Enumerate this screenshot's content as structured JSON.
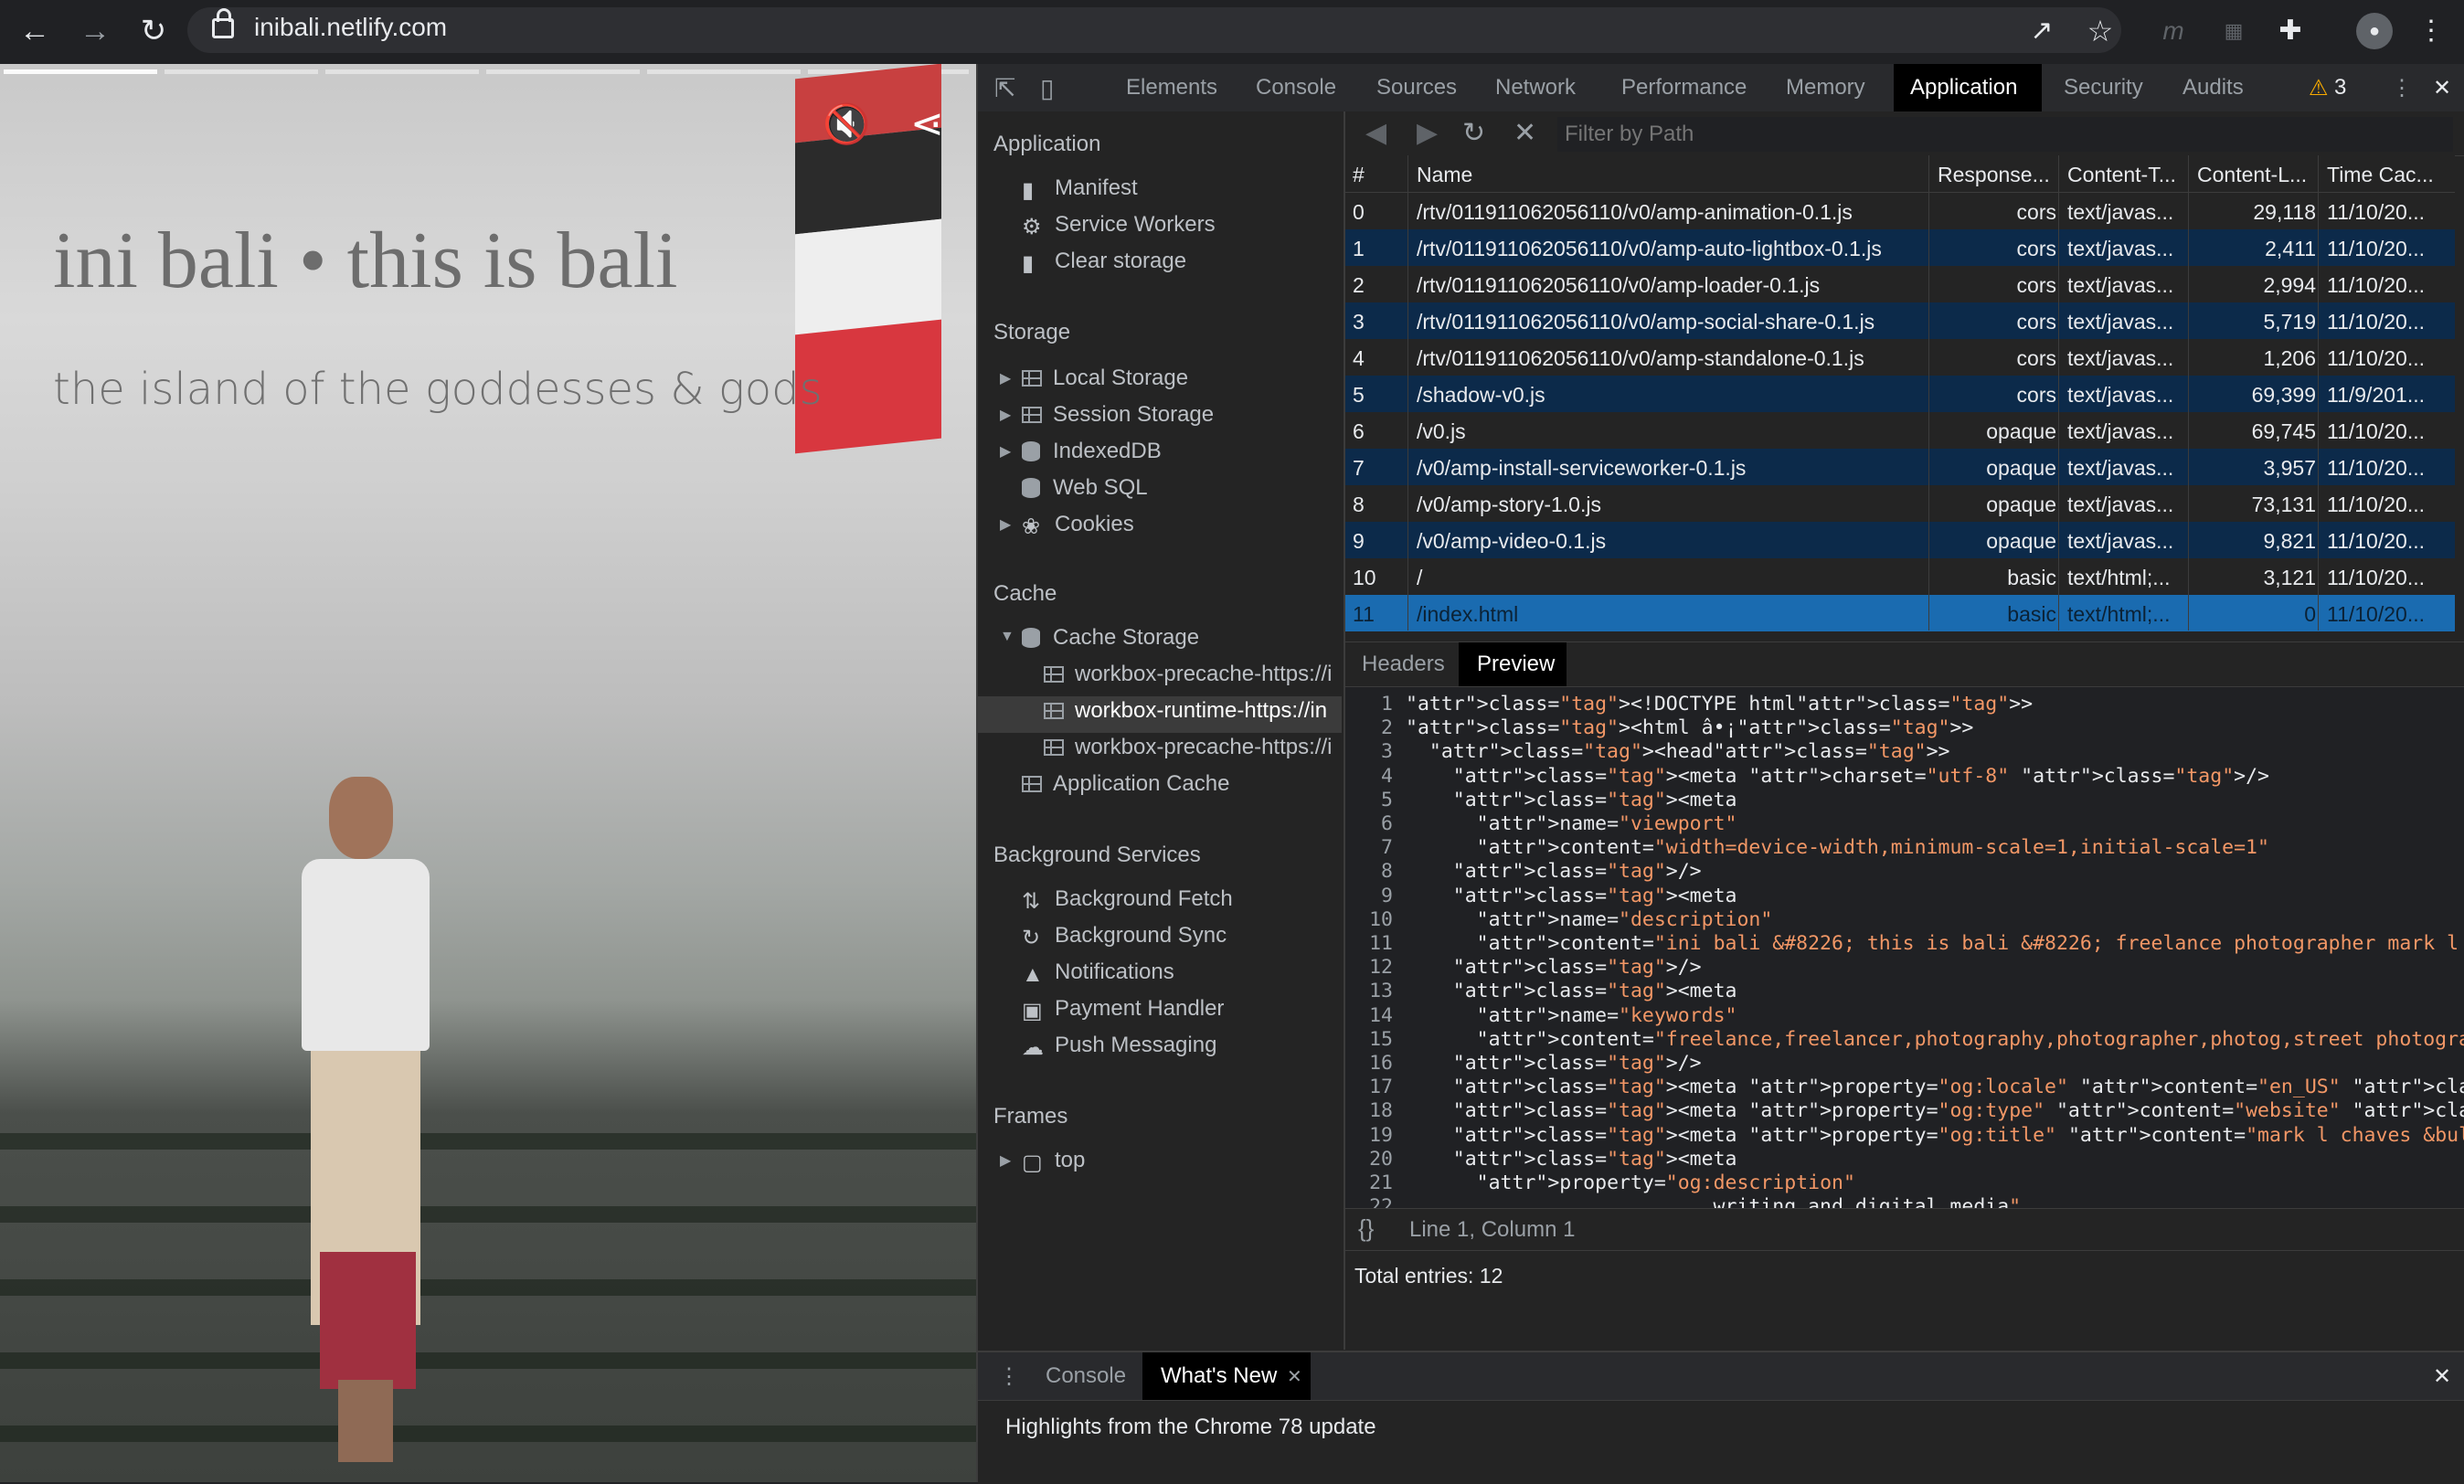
{
  "browser": {
    "url": "inibali.netlify.com",
    "icons": [
      "back-icon",
      "forward-icon",
      "reload-icon",
      "open-external-icon",
      "bookmark-star-icon",
      "extension-m-icon",
      "extension-se-icon",
      "puzzle-icon",
      "profile-avatar-icon",
      "menu-icon"
    ]
  },
  "page": {
    "title": "ini bali • this is bali",
    "subtitle": "the island of the goddesses & gods",
    "mute_icon": "🔇",
    "share_icon": "share-icon"
  },
  "devtools": {
    "tabs": [
      "Elements",
      "Console",
      "Sources",
      "Network",
      "Performance",
      "Memory",
      "Application",
      "Security",
      "Audits"
    ],
    "active_tab": "Application",
    "warning_count": "3",
    "sidebar": {
      "application": {
        "title": "Application",
        "items": [
          "Manifest",
          "Service Workers",
          "Clear storage"
        ]
      },
      "storage": {
        "title": "Storage",
        "items": [
          "Local Storage",
          "Session Storage",
          "IndexedDB",
          "Web SQL",
          "Cookies"
        ]
      },
      "cache": {
        "title": "Cache",
        "cache_storage": "Cache Storage",
        "entries": [
          "workbox-precache-https://i",
          "workbox-runtime-https://in",
          "workbox-precache-https://i"
        ],
        "app_cache": "Application Cache"
      },
      "background": {
        "title": "Background Services",
        "items": [
          "Background Fetch",
          "Background Sync",
          "Notifications",
          "Payment Handler",
          "Push Messaging"
        ]
      },
      "frames": {
        "title": "Frames",
        "items": [
          "top"
        ]
      }
    },
    "filter_placeholder": "Filter by Path",
    "table": {
      "headers": [
        "#",
        "Name",
        "Response...",
        "Content-T...",
        "Content-L...",
        "Time Cac..."
      ],
      "rows": [
        [
          "0",
          "/rtv/011911062056110/v0/amp-animation-0.1.js",
          "cors",
          "text/javas...",
          "29,118",
          "11/10/20..."
        ],
        [
          "1",
          "/rtv/011911062056110/v0/amp-auto-lightbox-0.1.js",
          "cors",
          "text/javas...",
          "2,411",
          "11/10/20..."
        ],
        [
          "2",
          "/rtv/011911062056110/v0/amp-loader-0.1.js",
          "cors",
          "text/javas...",
          "2,994",
          "11/10/20..."
        ],
        [
          "3",
          "/rtv/011911062056110/v0/amp-social-share-0.1.js",
          "cors",
          "text/javas...",
          "5,719",
          "11/10/20..."
        ],
        [
          "4",
          "/rtv/011911062056110/v0/amp-standalone-0.1.js",
          "cors",
          "text/javas...",
          "1,206",
          "11/10/20..."
        ],
        [
          "5",
          "/shadow-v0.js",
          "cors",
          "text/javas...",
          "69,399",
          "11/9/201..."
        ],
        [
          "6",
          "/v0.js",
          "opaque",
          "text/javas...",
          "69,745",
          "11/10/20..."
        ],
        [
          "7",
          "/v0/amp-install-serviceworker-0.1.js",
          "opaque",
          "text/javas...",
          "3,957",
          "11/10/20..."
        ],
        [
          "8",
          "/v0/amp-story-1.0.js",
          "opaque",
          "text/javas...",
          "73,131",
          "11/10/20..."
        ],
        [
          "9",
          "/v0/amp-video-0.1.js",
          "opaque",
          "text/javas...",
          "9,821",
          "11/10/20..."
        ],
        [
          "10",
          "/",
          "basic",
          "text/html;...",
          "3,121",
          "11/10/20..."
        ],
        [
          "11",
          "/index.html",
          "basic",
          "text/html;...",
          "0",
          "11/10/20..."
        ]
      ]
    },
    "preview_tabs": [
      "Headers",
      "Preview"
    ],
    "active_preview_tab": "Preview",
    "code_lines": [
      {
        "n": "1",
        "t": "<!DOCTYPE html>"
      },
      {
        "n": "2",
        "t": "<html â•¡>"
      },
      {
        "n": "3",
        "t": "  <head>"
      },
      {
        "n": "4",
        "t": "    <meta charset=\"utf-8\" />"
      },
      {
        "n": "5",
        "t": "    <meta"
      },
      {
        "n": "6",
        "t": "      name=\"viewport\""
      },
      {
        "n": "7",
        "t": "      content=\"width=device-width,minimum-scale=1,initial-scale=1\""
      },
      {
        "n": "8",
        "t": "    />"
      },
      {
        "n": "9",
        "t": "    <meta"
      },
      {
        "n": "10",
        "t": "      name=\"description\""
      },
      {
        "n": "11",
        "t": "      content=\"ini bali &#8226; this is bali &#8226; freelance photographer mark l chave"
      },
      {
        "n": "12",
        "t": "    />"
      },
      {
        "n": "13",
        "t": "    <meta"
      },
      {
        "n": "14",
        "t": "      name=\"keywords\""
      },
      {
        "n": "15",
        "t": "      content=\"freelance,freelancer,photography,photographer,photog,street photography,i"
      },
      {
        "n": "16",
        "t": "    />"
      },
      {
        "n": "17",
        "t": "    <meta property=\"og:locale\" content=\"en_US\" />"
      },
      {
        "n": "18",
        "t": "    <meta property=\"og:type\" content=\"website\" />"
      },
      {
        "n": "19",
        "t": "    <meta property=\"og:title\" content=\"mark l chaves &bull; creating\" />"
      },
      {
        "n": "20",
        "t": "    <meta"
      },
      {
        "n": "21",
        "t": "      property=\"og:description\""
      },
      {
        "n": "22",
        "t": "                          writing and digital media\""
      }
    ],
    "status": "Line 1, Column 1",
    "total_entries": "Total entries: 12",
    "drawer": {
      "tabs": [
        "Console",
        "What's New"
      ],
      "active": "What's New",
      "message": "Highlights from the Chrome 78 update"
    }
  }
}
